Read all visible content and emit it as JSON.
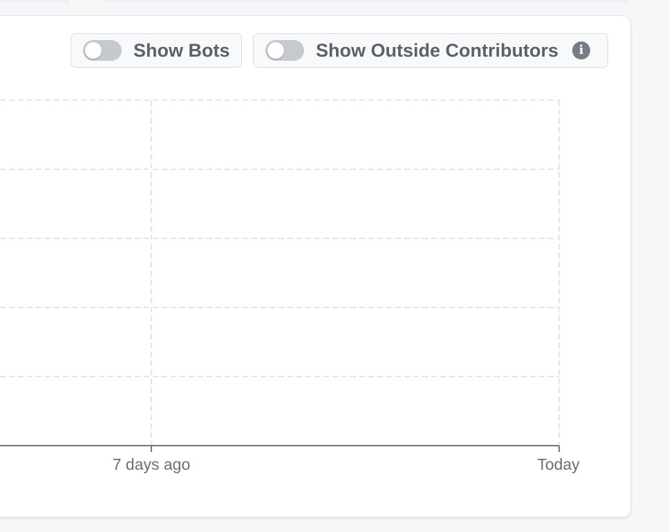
{
  "toggles": {
    "show_bots": {
      "label": "Show Bots",
      "state": "off"
    },
    "show_outside_contributors": {
      "label": "Show Outside Contributors",
      "state": "off",
      "icon": "info-icon"
    }
  },
  "chart_data": {
    "type": "line",
    "xlabel": "",
    "ylabel": "",
    "x_tick_labels": [
      "7 days ago",
      "Today"
    ],
    "series": [],
    "grid": true,
    "colors": {
      "grid": "#e2e4e8",
      "axis": "#6f737a",
      "tick_text": "#6a6f78"
    }
  }
}
